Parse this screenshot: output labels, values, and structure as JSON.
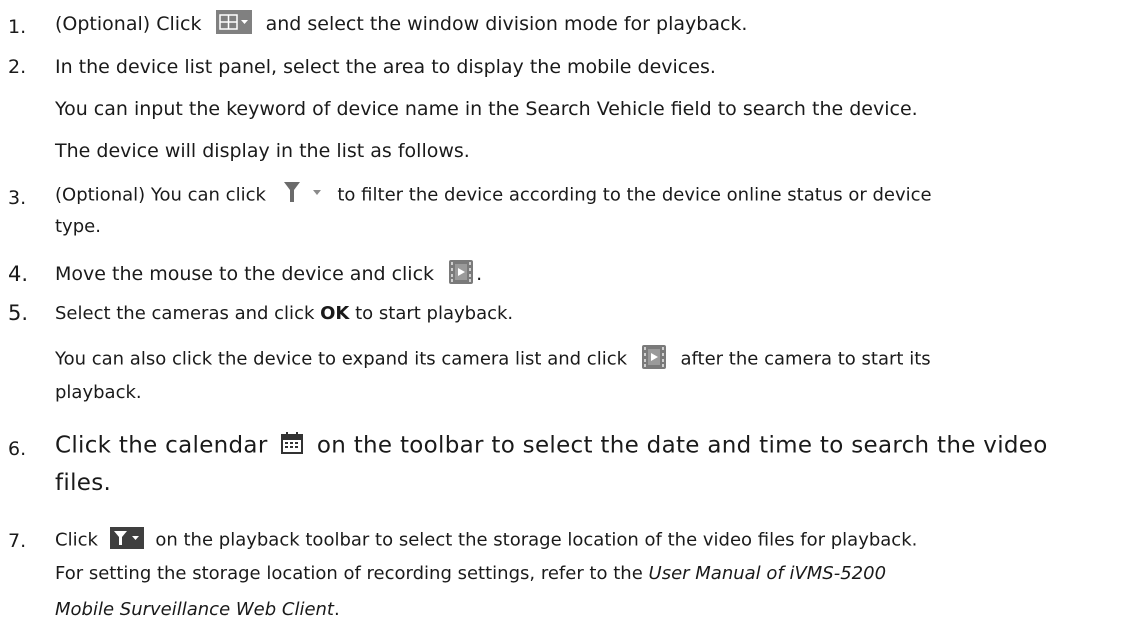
{
  "steps": [
    {
      "num": "1.",
      "before": "(Optional) Click",
      "after": "and select the window division mode for playback."
    },
    {
      "num": "2.",
      "text": "In the device list panel, select the area to display the mobile devices.",
      "sub": [
        "You can input the keyword of device name in the Search Vehicle field to search the device.",
        "The device will display in the list as follows."
      ]
    },
    {
      "num": "3.",
      "before": "(Optional) You can click",
      "after1": "to filter the device according to the device online status or device",
      "cont": "type."
    },
    {
      "num": "4.",
      "before": "Move the mouse to the device and click",
      "after": "."
    },
    {
      "num": "5.",
      "before": "Select the cameras and click",
      "bold": "OK",
      "after": "to start playback.",
      "sub_before": "You can also click the device to expand its camera list and click",
      "sub_after": "after the camera to start its",
      "sub_cont": "playback."
    },
    {
      "num": "6.",
      "before": "Click the calendar",
      "after": "on the toolbar to select the date and time to search the video",
      "cont": "files."
    },
    {
      "num": "7.",
      "before": "Click",
      "after": "on the playback toolbar to select the storage location of the video files for playback.",
      "sub1": "For setting the storage location of recording settings, refer to the",
      "sub1_italic": "User Manual of iVMS-5200",
      "sub2_italic": "Mobile Surveillance Web Client",
      "sub2_after": "."
    }
  ],
  "icons": [
    "window-division-icon",
    "filter-icon",
    "playback-icon",
    "calendar-icon",
    "storage-filter-icon"
  ]
}
